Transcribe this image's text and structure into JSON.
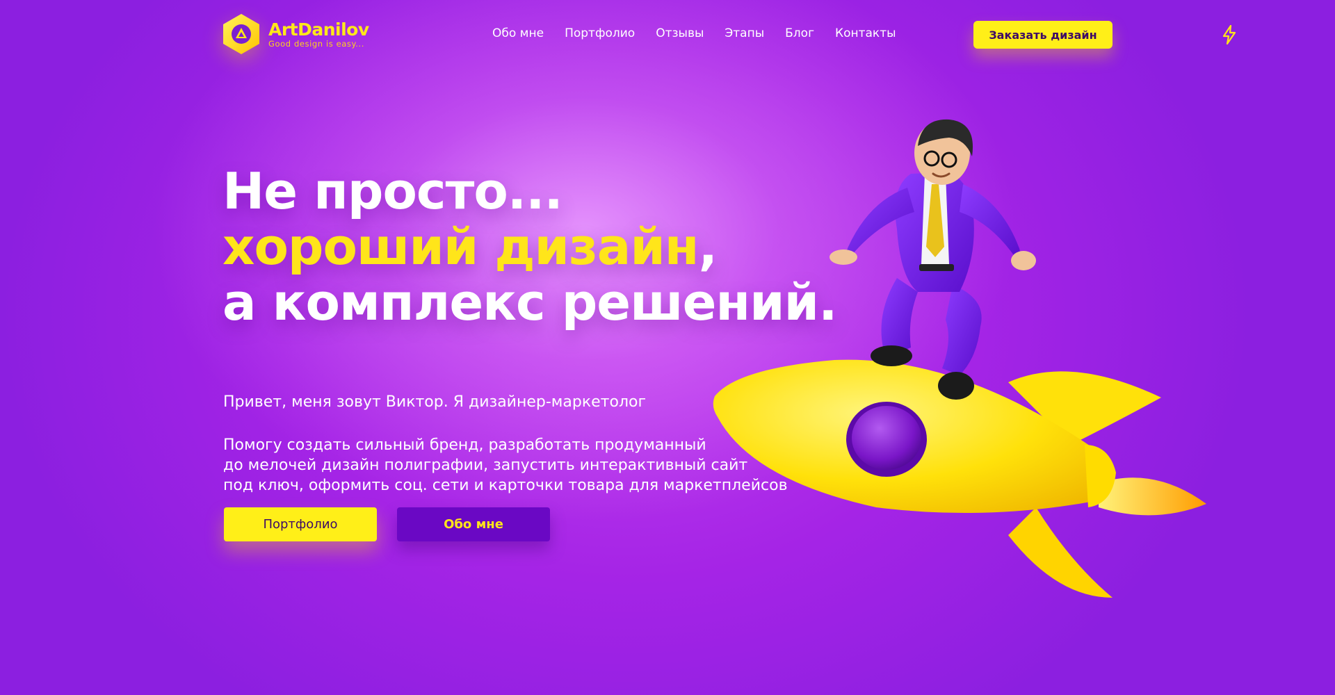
{
  "brand": {
    "name": "ArtDanilov",
    "tagline": "Good design is easy...",
    "accent_color": "#ffe81a",
    "background_color": "#a524e6"
  },
  "nav": {
    "items": [
      "Обо мне",
      "Портфолио",
      "Отзывы",
      "Этапы",
      "Блог",
      "Контакты"
    ],
    "order_button": "Заказать дизайн",
    "theme_icon": "lightning-icon"
  },
  "hero": {
    "title_line1": "Не просто...",
    "title_highlight": "хороший дизайн",
    "title_comma": ",",
    "title_line3": "а комплекс решений.",
    "intro": "Привет, меня зовут Виктор. Я дизайнер-маркетолог",
    "description_lines": [
      "Помогу создать сильный бренд,  разработать продуманный",
      "до мелочей дизайн полиграфии,  запустить интерактивный сайт",
      "под ключ, оформить соц. сети и карточки товара для маркетплейсов"
    ],
    "primary_button": "Портфолио",
    "secondary_button": "Обо мне",
    "illustration": "man-riding-rocket-illustration"
  }
}
